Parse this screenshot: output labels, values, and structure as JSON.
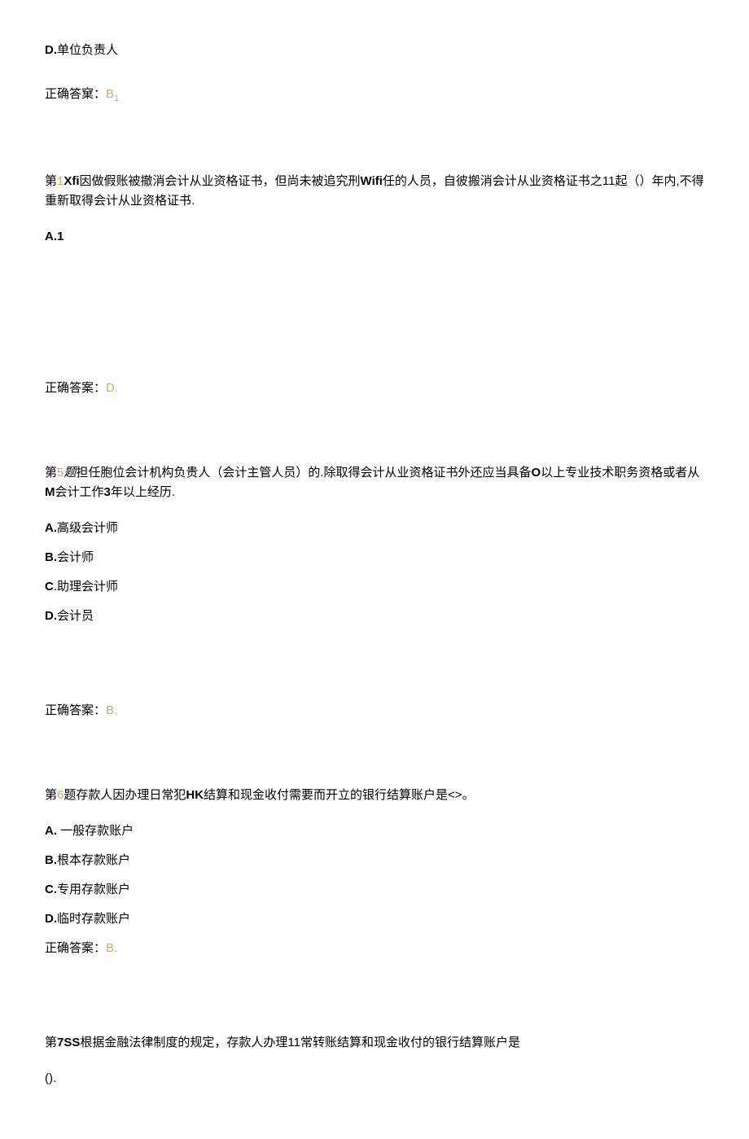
{
  "q3": {
    "optionD_label": "D.",
    "optionD_text": "单位负责人",
    "answer_label": "正确答窠：",
    "answer_value": "B",
    "answer_sub": "1"
  },
  "q4": {
    "prefix": "第",
    "num": "1",
    "bold_part1": "Xfi",
    "text1": "因做假账被撤消会计从业资格证书，但尚未被追究刑",
    "bold_part2": "Wifi",
    "text2": "任的人员，自彼搬消会计从业资格证书之11起（）年内,不得重新取得会计从业资格证书.",
    "optionA": "A.1",
    "answer_label": "正确答案：",
    "answer_value": "D."
  },
  "q5": {
    "prefix": "第",
    "num": "5",
    "italic": "题",
    "text1": "担任胞位会计机构负贵人（会计主管人员）的.除取得会计从业资格证书外还应当具备",
    "bold_part": "O",
    "text2": "以上专业技术职务资格或者从",
    "bold_part2": "M",
    "text3": "会计工作",
    "bold_part3": "3",
    "text4": "年以上经历.",
    "optionA_label": "A.",
    "optionA_text": "高级会计师",
    "optionB_label": "B.",
    "optionB_text": "会计师",
    "optionC_label": "C",
    "optionC_text": ".助理会计师",
    "optionD_label": "D.",
    "optionD_text": "会计员",
    "answer_label": "正确答案：",
    "answer_value": "B."
  },
  "q6": {
    "prefix": "第",
    "num": "6",
    "text1": "题存款人因办理日常犯",
    "bold_part": "HK",
    "text2": "结算和现金收付需要而开立的银行结算账户是<>。",
    "optionA_label": "A.",
    "optionA_text": "   一般存款账户",
    "optionB_label": "B.",
    "optionB_text": "根本存款账户",
    "optionC_label": "C.",
    "optionC_text": "专用存款账户",
    "optionD_label": "D.",
    "optionD_text": "临时存款账户",
    "answer_label": "正确答案：",
    "answer_value": "B."
  },
  "q7": {
    "prefix": "第",
    "bold_part": "7SS",
    "text": "根据金融法律制度的规定，存款人办理11常转账结算和现金收付的银行结算账户是",
    "paren": "()."
  }
}
